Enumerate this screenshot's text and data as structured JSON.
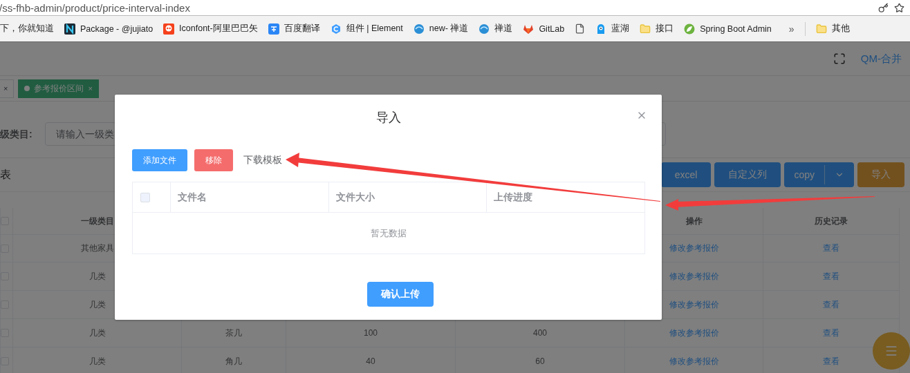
{
  "browser": {
    "url": "/ss-fhb-admin/product/price-interval-index",
    "bookmarks": [
      {
        "label": "下，你就知道"
      },
      {
        "label": "Package - @jujiato"
      },
      {
        "label": "Iconfont-阿里巴巴矢"
      },
      {
        "label": "百度翻译"
      },
      {
        "label": "组件 | Element"
      },
      {
        "label": "new- 禅道"
      },
      {
        "label": "禅道"
      },
      {
        "label": "GitLab"
      },
      {
        "label": "蓝湖"
      },
      {
        "label": "接口"
      },
      {
        "label": "Spring Boot Admin"
      }
    ],
    "more": "»",
    "other_bookmarks": "其他"
  },
  "header": {
    "user": "QM-合并"
  },
  "tabs": [
    {
      "close": "×",
      "selected": false
    },
    {
      "label": "参考报价区间",
      "close": "×",
      "selected": true
    }
  ],
  "filter": {
    "label": "级类目:",
    "placeholder": "请输入一级类"
  },
  "toolbar": {
    "title": "表",
    "buttons": [
      {
        "label": "excel",
        "kind": "primary"
      },
      {
        "label": "自定义列",
        "kind": "primary"
      },
      {
        "label": "copy",
        "kind": "split"
      },
      {
        "label": "导入",
        "kind": "warning"
      }
    ]
  },
  "table": {
    "select_all_checked": false,
    "columns": {
      "column_1": "一级类目",
      "action": "操作",
      "history": "历史记录"
    },
    "rows": [
      {
        "checked": false,
        "column_1": "其他家具",
        "action": "修改参考报价",
        "history": "查看"
      },
      {
        "checked": false,
        "column_1": "几类",
        "action": "修改参考报价",
        "history": "查看"
      },
      {
        "checked": false,
        "column_1": "几类",
        "action": "修改参考报价",
        "history": "查看"
      },
      {
        "checked": false,
        "column_1": "几类",
        "column_2": "茶几",
        "column_3": "100",
        "column_4": "400",
        "action": "修改参考报价",
        "history": "查看"
      },
      {
        "checked": false,
        "column_1": "几类",
        "column_2": "角几",
        "column_3": "40",
        "column_4": "60",
        "action": "修改参考报价",
        "history": "查看"
      }
    ]
  },
  "dialog": {
    "title": "导入",
    "buttons": [
      {
        "label": "添加文件",
        "kind": "primary"
      },
      {
        "label": "移除",
        "kind": "danger"
      },
      {
        "label": "下载模板",
        "kind": "text"
      }
    ],
    "table": {
      "select_all_checked": false,
      "columns": [
        "文件名",
        "文件大小",
        "上传进度"
      ],
      "empty_text": "暂无数据"
    },
    "submit": "确认上传"
  }
}
